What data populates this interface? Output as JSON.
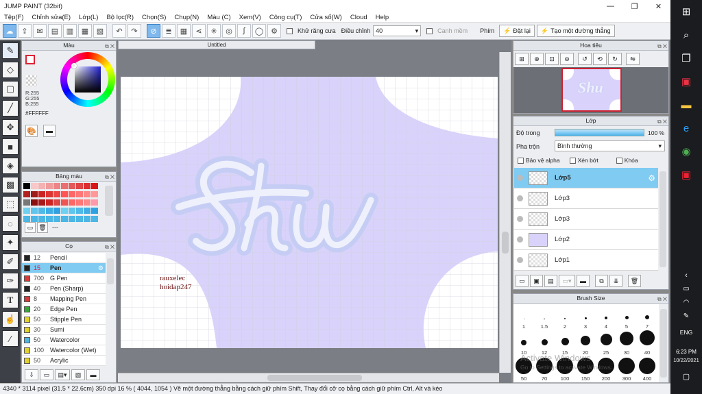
{
  "window": {
    "title": "JUMP PAINT (32bit)",
    "btn_min": "—",
    "btn_max": "❐",
    "btn_close": "✕"
  },
  "menu": [
    "Tệp(F)",
    "Chỉnh sửa(E)",
    "Lớp(L)",
    "Bộ lọc(R)",
    "Chọn(S)",
    "Chụp(N)",
    "Màu (C)",
    "Xem(V)",
    "Công cụ(T)",
    "Cửa sổ(W)",
    "Cloud",
    "Help"
  ],
  "toolbar": {
    "antialias": "Khử răng cưa",
    "adjust": "Điều chỉnh",
    "adjust_value": "40",
    "smooth": "Canh mềm",
    "key": "Phím",
    "reset": "Đặt lại",
    "straight": "Tạo một đường thẳng"
  },
  "color_panel": {
    "title": "Màu",
    "r": "R:255",
    "g": "G:255",
    "b": "B:255",
    "hex": "#FFFFFF"
  },
  "palette_panel": {
    "title": "Bảng màu",
    "dash": "---"
  },
  "brush_panel": {
    "title": "Cọ",
    "items": [
      {
        "size": "12",
        "name": "Pencil",
        "color": "#222222"
      },
      {
        "size": "15",
        "name": "Pen",
        "color": "#222222"
      },
      {
        "size": "700",
        "name": "G Pen",
        "color": "#d63a3a"
      },
      {
        "size": "40",
        "name": "Pen (Sharp)",
        "color": "#222222"
      },
      {
        "size": "8",
        "name": "Mapping Pen",
        "color": "#d63a3a"
      },
      {
        "size": "20",
        "name": "Edge Pen",
        "color": "#37a43a"
      },
      {
        "size": "50",
        "name": "Stipple Pen",
        "color": "#e3d22d"
      },
      {
        "size": "30",
        "name": "Sumi",
        "color": "#e3d22d"
      },
      {
        "size": "50",
        "name": "Watercolor",
        "color": "#4fb6e3"
      },
      {
        "size": "100",
        "name": "Watercolor (Wet)",
        "color": "#e3d22d"
      },
      {
        "size": "50",
        "name": "Acrylic",
        "color": "#e3d22d"
      }
    ],
    "selected": 1
  },
  "document": {
    "tab": "Untitled",
    "artwork_text": "Shu",
    "watermark_line1": "rauxelec",
    "watermark_line2": "hoidap247"
  },
  "navigator": {
    "title": "Hoa tiêu"
  },
  "layer_panel": {
    "title": "Lớp",
    "opacity_label": "Độ trong",
    "opacity_value": "100 %",
    "opacity_fraction": 1.0,
    "blend_label": "Pha trộn",
    "blend_value": "Bình thường",
    "protect_alpha": "Bảo vệ alpha",
    "clip": "Xén bớt",
    "lock": "Khóa",
    "layers": [
      {
        "name": "Lớp5"
      },
      {
        "name": "Lớp3"
      },
      {
        "name": "Lớp3"
      },
      {
        "name": "Lớp2"
      },
      {
        "name": "Lớp1"
      }
    ],
    "selected": 0
  },
  "brush_size": {
    "title": "Brush Size",
    "row1": [
      "1",
      "1.5",
      "2",
      "3",
      "4",
      "5",
      "7"
    ],
    "row2": [
      "10",
      "12",
      "15",
      "20",
      "25",
      "30",
      "40"
    ],
    "row3": [
      "50",
      "70",
      "100",
      "150",
      "200",
      "300",
      "400"
    ]
  },
  "activate": {
    "line1": "Activate Windows",
    "line2": "Go to Settings to activate Windows."
  },
  "status": {
    "text": "4340 * 3114 pixel   (31.5 * 22.6cm)   350 dpi   16 %   ( 4044, 1054 )   Vẽ một đường thẳng bằng cách giữ phím Shift, Thay đổi cỡ cọ bằng cách giữ phím Ctrl, Alt và kéo"
  },
  "taskbar": {
    "lang": "ENG",
    "time": "6:23 PM",
    "date": "10/22/2021"
  },
  "colors": {
    "blob": "#d9d3fb",
    "text_fill": "#d4d9f7",
    "accent": "#7fcbf2"
  }
}
